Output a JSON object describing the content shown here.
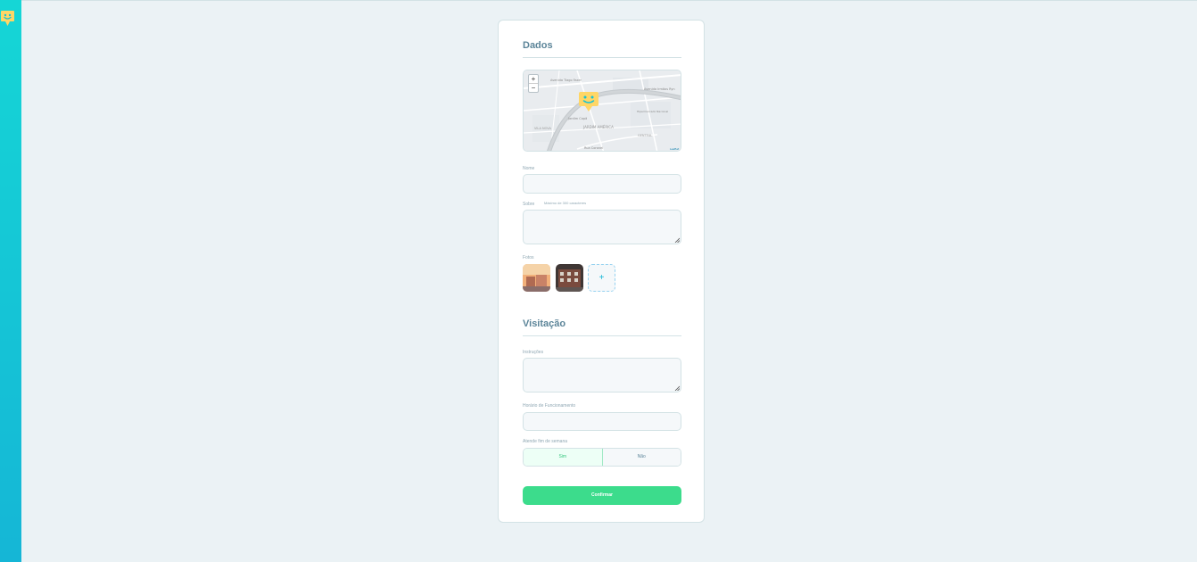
{
  "brand": {
    "accent": "#15c3d6",
    "success": "#3cdc8c",
    "pin_color": "#ffd666"
  },
  "sidebar": {
    "logo_icon": "happy-pin-icon"
  },
  "form": {
    "dados_title": "Dados",
    "map": {
      "zoom_in": "+",
      "zoom_out": "−",
      "labels": [
        "Avenida Tiago Fazer",
        "Avenida Irmãos Ryn",
        "Jardim Capã",
        "VILA NOVA",
        "JARDIM AMÉRICA",
        "Hipermercado Nacional",
        "GENTEAL",
        "Rua Coronel"
      ],
      "attribution": "Leaflet"
    },
    "nome": {
      "label": "Nome",
      "value": ""
    },
    "sobre": {
      "label": "Sobre",
      "hint": "Máximo de 300 caracteres",
      "value": ""
    },
    "fotos": {
      "label": "Fotos",
      "add_label": "+"
    },
    "visitacao_title": "Visitação",
    "instrucoes": {
      "label": "Instruções",
      "value": ""
    },
    "horario": {
      "label": "Horário de Funcionamento",
      "value": ""
    },
    "fim_semana": {
      "label": "Atende fim de semana",
      "yes": "Sim",
      "no": "Não",
      "selected": "Sim"
    },
    "confirm_label": "Confirmar"
  }
}
